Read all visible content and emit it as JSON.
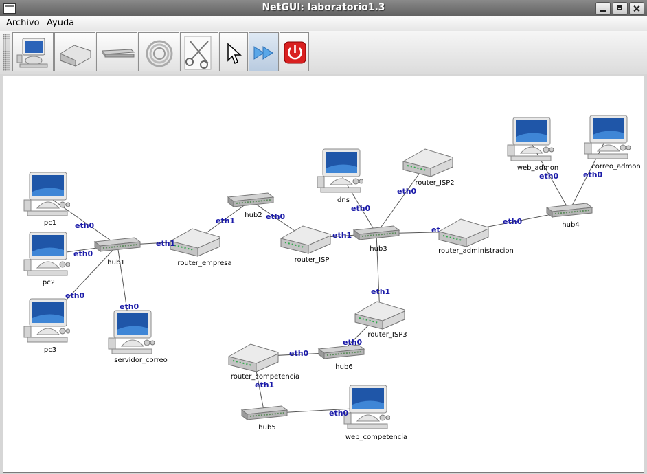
{
  "window": {
    "title": "NetGUI: laboratorio1.3"
  },
  "menu": {
    "archivo": "Archivo",
    "ayuda": "Ayuda"
  },
  "toolbar": {
    "buttons": [
      "pc-tool",
      "router-tool",
      "hub-tool",
      "cable-tool",
      "cut-tool",
      "pointer-tool",
      "forward-tool",
      "power-tool"
    ]
  },
  "nodes": {
    "pc1": "pc1",
    "pc2": "pc2",
    "pc3": "pc3",
    "servidor_correo": "servidor_correo",
    "hub1": "hub1",
    "hub2": "hub2",
    "hub3": "hub3",
    "hub4": "hub4",
    "hub5": "hub5",
    "hub6": "hub6",
    "router_empresa": "router_empresa",
    "router_ISP": "router_ISP",
    "router_ISP2": "router_ISP2",
    "router_ISP3": "router_ISP3",
    "router_administracion": "router_administracion",
    "router_competencia": "router_competencia",
    "dns": "dns",
    "web_admon": "web_admon",
    "correo_admon": "correo_admon",
    "web_competencia": "web_competencia"
  },
  "interfaces": {
    "pc1_eth0": "eth0",
    "pc2_eth0": "eth0",
    "pc3_eth0": "eth0",
    "servidor_correo_eth0": "eth0",
    "router_empresa_eth1": "eth1",
    "router_empresa_eth0": "eth1",
    "router_ISP_eth0": "eth0",
    "router_ISP_eth1": "eth1",
    "dns_eth0": "eth0",
    "router_ISP2_eth0": "eth0",
    "router_administracion_et": "et",
    "router_administracion_eth0": "eth0",
    "web_admon_eth0": "eth0",
    "correo_admon_eth0": "eth0",
    "router_ISP3_eth1": "eth1",
    "router_ISP3_eth0": "eth0",
    "router_competencia_eth0": "eth0",
    "router_competencia_eth1": "eth1",
    "web_competencia_eth0": "eth0"
  },
  "colors": {
    "interface_label": "#1a1aa8",
    "link": "#555555",
    "title_bar": "#6e6e6e"
  }
}
